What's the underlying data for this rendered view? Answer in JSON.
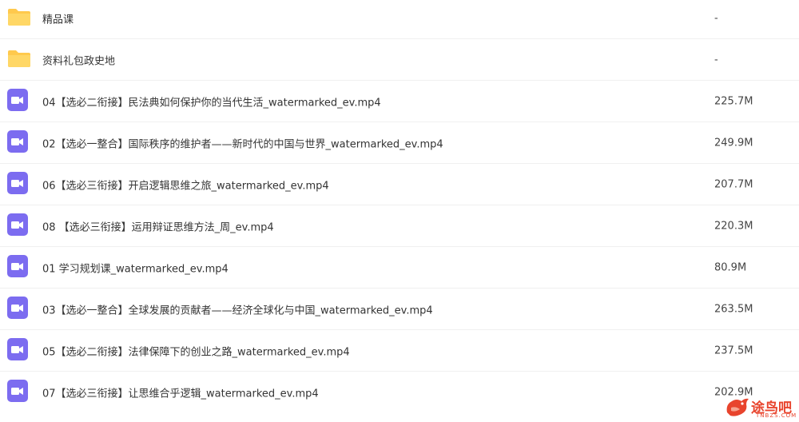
{
  "files": [
    {
      "type": "folder",
      "name": "精品课",
      "size": "-"
    },
    {
      "type": "folder",
      "name": "资料礼包政史地",
      "size": "-"
    },
    {
      "type": "video",
      "name": "04【选必二衔接】民法典如何保护你的当代生活_watermarked_ev.mp4",
      "size": "225.7M"
    },
    {
      "type": "video",
      "name": "02【选必一整合】国际秩序的维护者——新时代的中国与世界_watermarked_ev.mp4",
      "size": "249.9M"
    },
    {
      "type": "video",
      "name": "06【选必三衔接】开启逻辑思维之旅_watermarked_ev.mp4",
      "size": "207.7M"
    },
    {
      "type": "video",
      "name": "08 【选必三衔接】运用辩证思维方法_周_ev.mp4",
      "size": "220.3M"
    },
    {
      "type": "video",
      "name": "01 学习规划课_watermarked_ev.mp4",
      "size": "80.9M"
    },
    {
      "type": "video",
      "name": "03【选必一整合】全球发展的贡献者——经济全球化与中国_watermarked_ev.mp4",
      "size": "263.5M"
    },
    {
      "type": "video",
      "name": "05【选必二衔接】法律保障下的创业之路_watermarked_ev.mp4",
      "size": "237.5M"
    },
    {
      "type": "video",
      "name": "07【选必三衔接】让思维合乎逻辑_watermarked_ev.mp4",
      "size": "202.9M"
    }
  ],
  "watermark": {
    "text": "途鸟吧",
    "sub": "TNBZS.COM"
  },
  "colors": {
    "folder": "#ffc94d",
    "video": "#7c6cf0",
    "watermark": "#e8442d"
  }
}
